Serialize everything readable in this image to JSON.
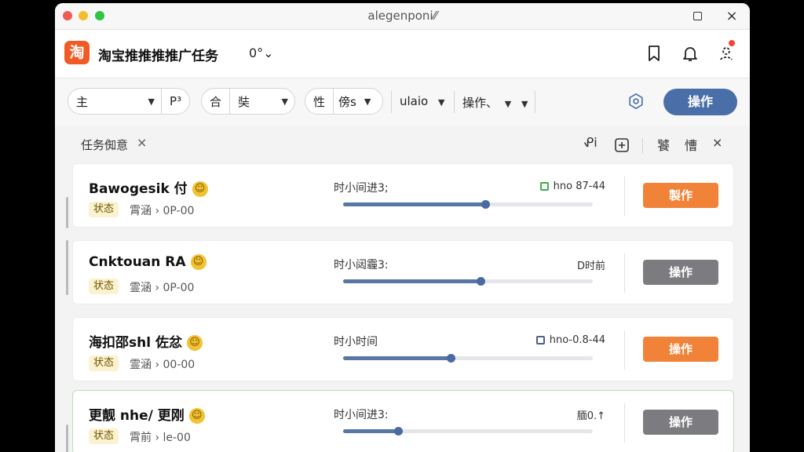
{
  "window": {
    "title": "alegenponi⁄⁄"
  },
  "app": {
    "logo_text": "淘",
    "title": "淘宝推推推推广任务",
    "dropdown_label": "0°⌄"
  },
  "filters": {
    "pill1": {
      "left": "主",
      "right": "P³"
    },
    "pill2": {
      "left": "合",
      "right": "奘"
    },
    "pill3": {
      "left": "性",
      "right": "傍s"
    },
    "dropdown1": "ulaio",
    "dropdown2": "操作、",
    "primary_button": "操作"
  },
  "tabbar": {
    "tab_label": "任务倁意",
    "close": "×",
    "icon1": "ᕵi",
    "label1": "饕",
    "label2": "慒",
    "close2": "×"
  },
  "colors": {
    "primary": "#4a6fa8",
    "orange": "#f08338",
    "gray": "#7c7c80",
    "accent_logo": "#f15a24"
  },
  "cards": [
    {
      "title": "Bawogesik 付",
      "status": "状态",
      "sub": "霄涵 › 0P-00",
      "mid": "时小间进3;",
      "progress": 0.57,
      "right_text": "hno 87-44",
      "right_marker": "green-square",
      "button": "製作",
      "button_style": "orange"
    },
    {
      "title": "Cnktouan RA",
      "status": "状态",
      "sub": "霊涵 › 0P-00",
      "mid": "时小闼霾3:",
      "progress": 0.55,
      "right_text": "D时前",
      "right_marker": "",
      "button": "操作",
      "button_style": "gray"
    },
    {
      "title": "海扣邵shl 佐忿",
      "status": "状态",
      "sub": "霊涵 › 00-00",
      "mid": "时小时间",
      "progress": 0.43,
      "right_text": "hno-0.8-44",
      "right_marker": "blue-square",
      "button": "操作",
      "button_style": "orange"
    },
    {
      "title": "更靓 nhe/ 更刚",
      "status": "状态",
      "sub": "霄前 › le-00",
      "mid": "时小间进3:",
      "progress": 0.22,
      "right_text": "腼0.↑",
      "right_marker": "",
      "button": "操作",
      "button_style": "gray"
    }
  ]
}
